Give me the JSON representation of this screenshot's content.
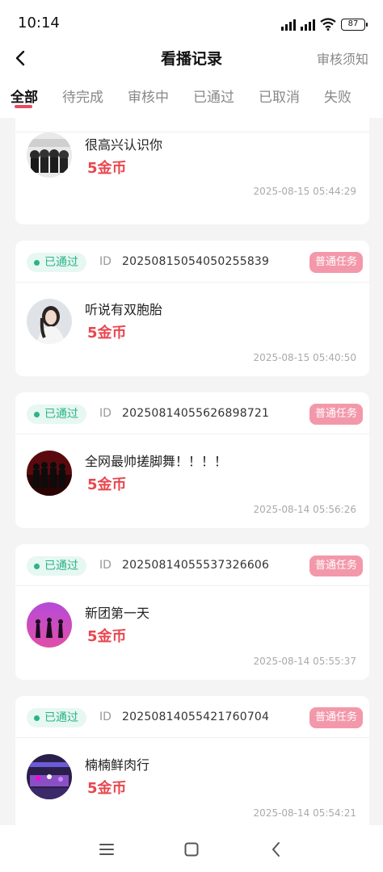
{
  "status_bar": {
    "time": "10:14",
    "battery": "87"
  },
  "header": {
    "title": "看播记录",
    "notice": "审核须知"
  },
  "tabs": [
    {
      "label": "全部",
      "active": true
    },
    {
      "label": "待完成",
      "active": false
    },
    {
      "label": "审核中",
      "active": false
    },
    {
      "label": "已通过",
      "active": false
    },
    {
      "label": "已取消",
      "active": false
    },
    {
      "label": "失败",
      "active": false
    }
  ],
  "records": [
    {
      "title": "很高兴认识你",
      "reward": "5金币",
      "time": "2025-08-15 05:44:29"
    },
    {
      "status": "已通过",
      "id_label": "ID",
      "id": "20250815054050255839",
      "badge": "普通任务",
      "title": "听说有双胞胎",
      "reward": "5金币",
      "time": "2025-08-15 05:40:50"
    },
    {
      "status": "已通过",
      "id_label": "ID",
      "id": "20250814055626898721",
      "badge": "普通任务",
      "title": "全网最帅搓脚舞！！！！",
      "reward": "5金币",
      "time": "2025-08-14 05:56:26"
    },
    {
      "status": "已通过",
      "id_label": "ID",
      "id": "20250814055537326606",
      "badge": "普通任务",
      "title": "新团第一天",
      "reward": "5金币",
      "time": "2025-08-14 05:55:37"
    },
    {
      "status": "已通过",
      "id_label": "ID",
      "id": "20250814055421760704",
      "badge": "普通任务",
      "title": "楠楠鲜肉行",
      "reward": "5金币",
      "time": "2025-08-14 05:54:21"
    }
  ],
  "colors": {
    "accent": "#e84a5f",
    "passed": "#2bb38a",
    "reward": "#e8474f",
    "badge": "#f398aa"
  }
}
